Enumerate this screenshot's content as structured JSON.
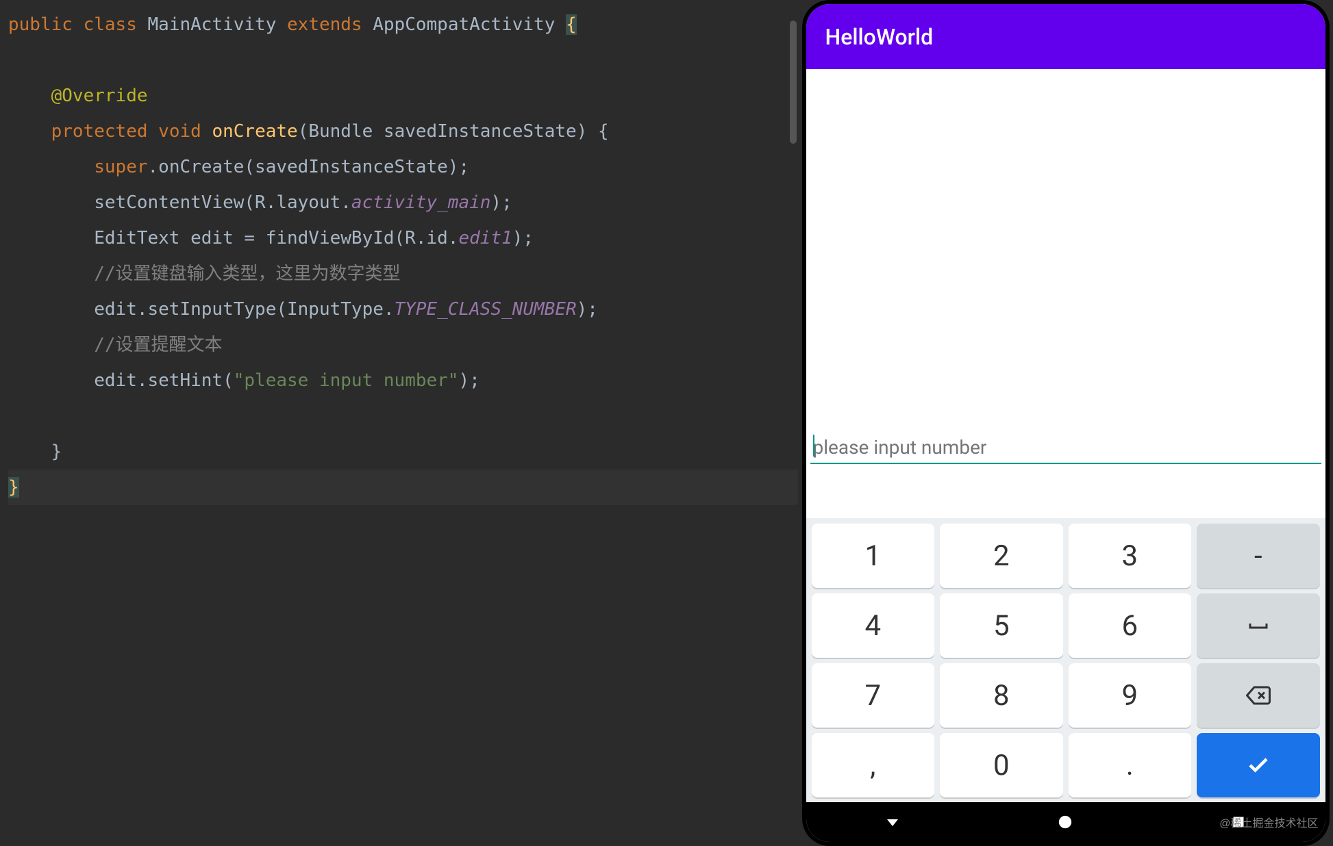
{
  "editor": {
    "code": {
      "l1_public": "public",
      "l1_class": "class",
      "l1_name": "MainActivity",
      "l1_extends": "extends",
      "l1_parent": "AppCompatActivity",
      "l2_override": "@Override",
      "l3_protected": "protected",
      "l3_void": "void",
      "l3_method": "onCreate",
      "l3_params": "(Bundle savedInstanceState) {",
      "l4_super": "super",
      "l4_call": ".onCreate(savedInstanceState);",
      "l5_setview": "setContentView(R.layout.",
      "l5_layout": "activity_main",
      "l5_end": ");",
      "l6_type": "EditText edit = findViewById(R.id.",
      "l6_id": "edit1",
      "l6_end": ");",
      "l7_comment": "//设置键盘输入类型，这里为数字类型",
      "l8_call": "edit.setInputType(InputType.",
      "l8_const": "TYPE_CLASS_NUMBER",
      "l8_end": ");",
      "l9_comment": "//设置提醒文本",
      "l10_call": "edit.setHint(",
      "l10_str": "\"please input number\"",
      "l10_end": ");",
      "l11_brace": "}",
      "l12_brace": "}"
    }
  },
  "emulator": {
    "app_title": "HelloWorld",
    "edit_placeholder": "please input number",
    "keyboard": {
      "r1": [
        "1",
        "2",
        "3",
        "-"
      ],
      "r2": [
        "4",
        "5",
        "6",
        "␣"
      ],
      "r3": [
        "7",
        "8",
        "9",
        "⌫"
      ],
      "r4": [
        ",",
        "0",
        ".",
        "✓"
      ]
    },
    "watermark": "@稀土掘金技术社区"
  }
}
